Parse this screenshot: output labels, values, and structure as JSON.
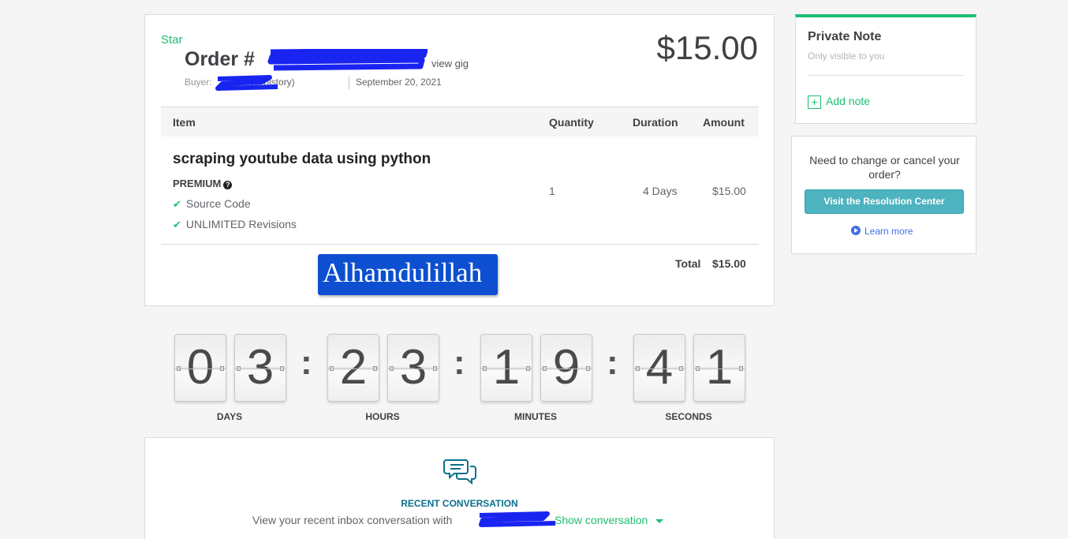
{
  "order": {
    "star_label": "Star",
    "title_prefix": "Order #",
    "view_gig_label": "view gig",
    "buyer_label": "Buyer:",
    "view_history_label": "view history)",
    "date": "September 20, 2021",
    "price": "$15.00"
  },
  "table": {
    "headers": {
      "item": "Item",
      "quantity": "Quantity",
      "duration": "Duration",
      "amount": "Amount"
    },
    "row": {
      "title": "scraping youtube data using python",
      "package": "PREMIUM",
      "features": [
        "Source Code",
        "UNLIMITED Revisions"
      ],
      "quantity": "1",
      "duration": "4 Days",
      "amount": "$15.00"
    },
    "total_label": "Total",
    "total_value": "$15.00"
  },
  "overlay_text": "Alhamdulillah",
  "countdown": {
    "days": [
      "0",
      "3"
    ],
    "hours": [
      "2",
      "3"
    ],
    "minutes": [
      "1",
      "9"
    ],
    "seconds": [
      "4",
      "1"
    ],
    "labels": {
      "days": "DAYS",
      "hours": "HOURS",
      "minutes": "MINUTES",
      "seconds": "SECONDS"
    },
    "separator": ":"
  },
  "conversation": {
    "title": "RECENT CONVERSATION",
    "text": "View your recent inbox conversation with",
    "show_label": "Show conversation"
  },
  "private_note": {
    "title": "Private Note",
    "subtitle": "Only visible to you",
    "add_label": "Add note"
  },
  "resolution": {
    "question": "Need to change or cancel your order?",
    "button_label": "Visit the Resolution Center",
    "learn_more_label": "Learn more"
  },
  "colors": {
    "brand_green": "#1dbf73",
    "resolution_button": "#4db3bf",
    "overlay_blue": "#0d4fd0",
    "redaction_blue": "#1a24f0"
  },
  "icons": [
    "question-icon",
    "check-icon",
    "chat-bubbles-icon",
    "caret-down-icon",
    "plus-square-icon",
    "play-circle-icon"
  ]
}
